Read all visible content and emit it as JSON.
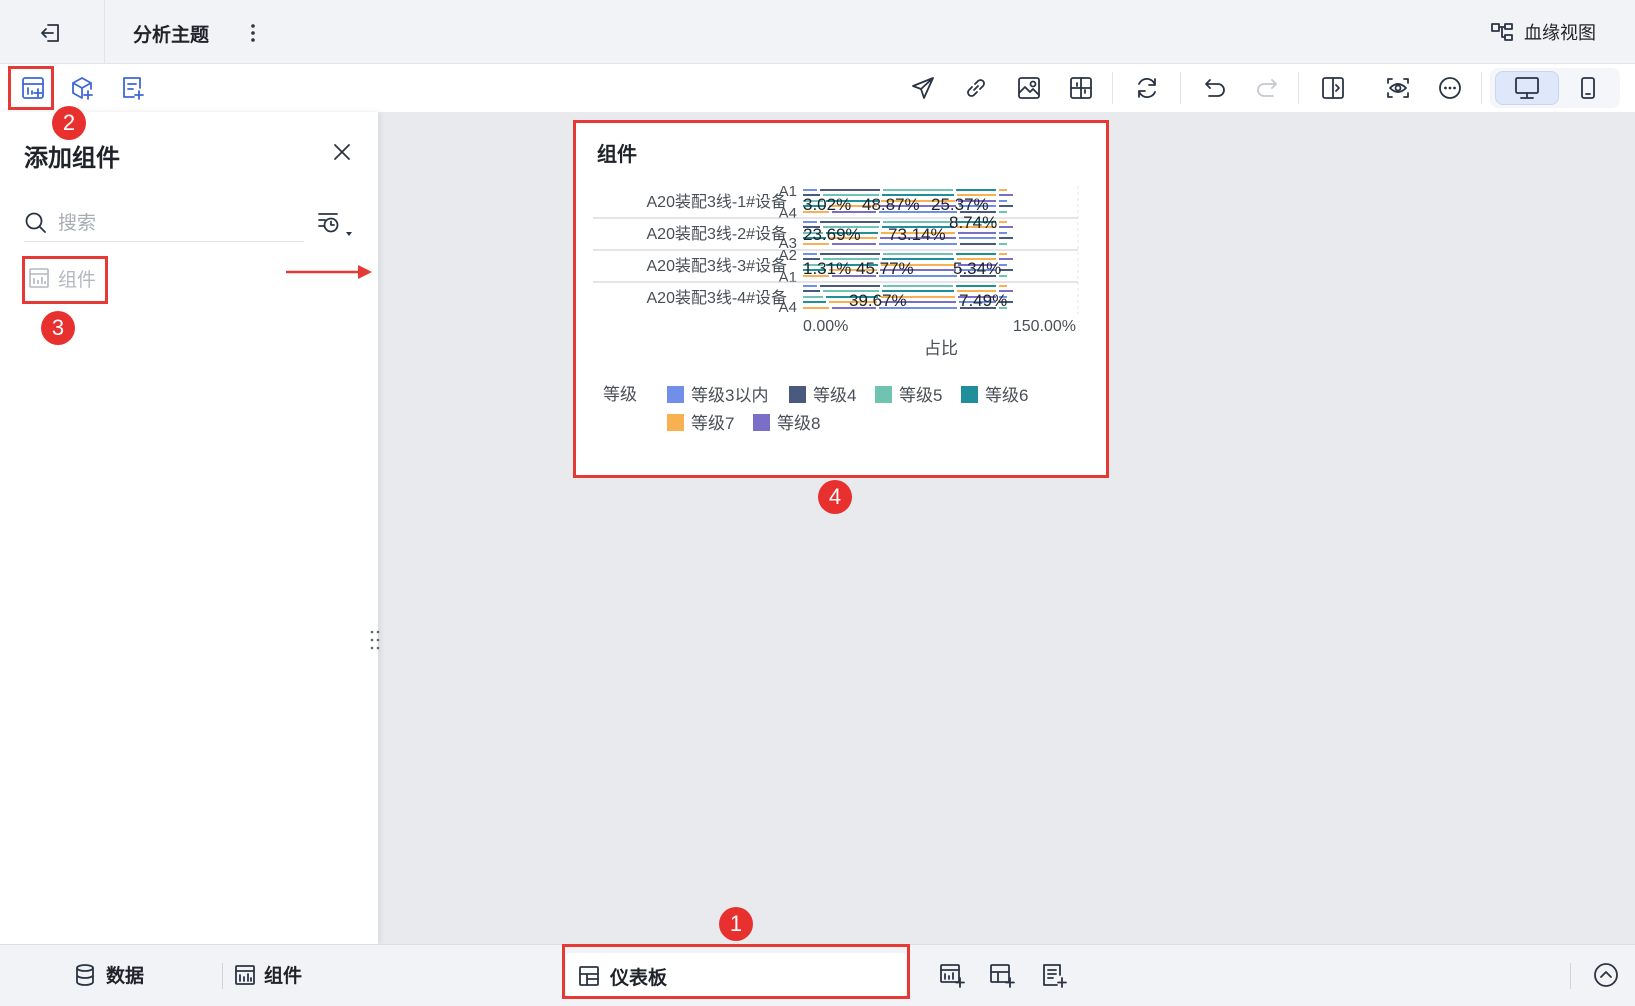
{
  "header": {
    "title": "分析主题",
    "lineage_label": "血缘视图"
  },
  "panel": {
    "title": "添加组件",
    "search_placeholder": "搜索",
    "item_label": "组件"
  },
  "annotations": [
    "1",
    "2",
    "3",
    "4"
  ],
  "widget": {
    "title": "组件"
  },
  "bottom": {
    "data_tab": "数据",
    "components_tab": "组件",
    "dashboard_tab": "仪表板"
  },
  "colors": {
    "accent": "#3f67d8",
    "callout_red": "#e53935"
  },
  "chart_data": {
    "type": "bar",
    "orientation": "horizontal",
    "stacked": true,
    "xlabel": "占比",
    "x_ticks": [
      "0.00%",
      "150.00%"
    ],
    "xlim": [
      0,
      150
    ],
    "legend_title": "等级",
    "legend_position": "bottom",
    "groups": [
      {
        "name": "A20装配3线-1#设备",
        "sub": [
          "A1",
          "A4"
        ]
      },
      {
        "name": "A20装配3线-2#设备",
        "sub": [
          "A3"
        ]
      },
      {
        "name": "A20装配3线-3#设备",
        "sub": [
          "A2",
          "A1"
        ]
      },
      {
        "name": "A20装配3线-4#设备",
        "sub": [
          "A4"
        ]
      }
    ],
    "series": [
      {
        "name": "等级3以内",
        "color": "#6f8fe8"
      },
      {
        "name": "等级4",
        "color": "#4a5a7e"
      },
      {
        "name": "等级5",
        "color": "#6fc3b0"
      },
      {
        "name": "等级6",
        "color": "#1f8f9c"
      },
      {
        "name": "等级7",
        "color": "#f9b050"
      },
      {
        "name": "等级8",
        "color": "#7a6fc8"
      }
    ],
    "data_labels": [
      {
        "group": 0,
        "texts": [
          "3.02%",
          "48.87%",
          "25.37%"
        ]
      },
      {
        "group": 1,
        "texts": [
          "23.69%",
          "73.14%",
          "8.74%"
        ]
      },
      {
        "group": 2,
        "texts": [
          "1.31%",
          "45.77%",
          "5.34%"
        ]
      },
      {
        "group": 3,
        "texts": [
          "39.67%",
          "7.49%"
        ]
      }
    ]
  }
}
